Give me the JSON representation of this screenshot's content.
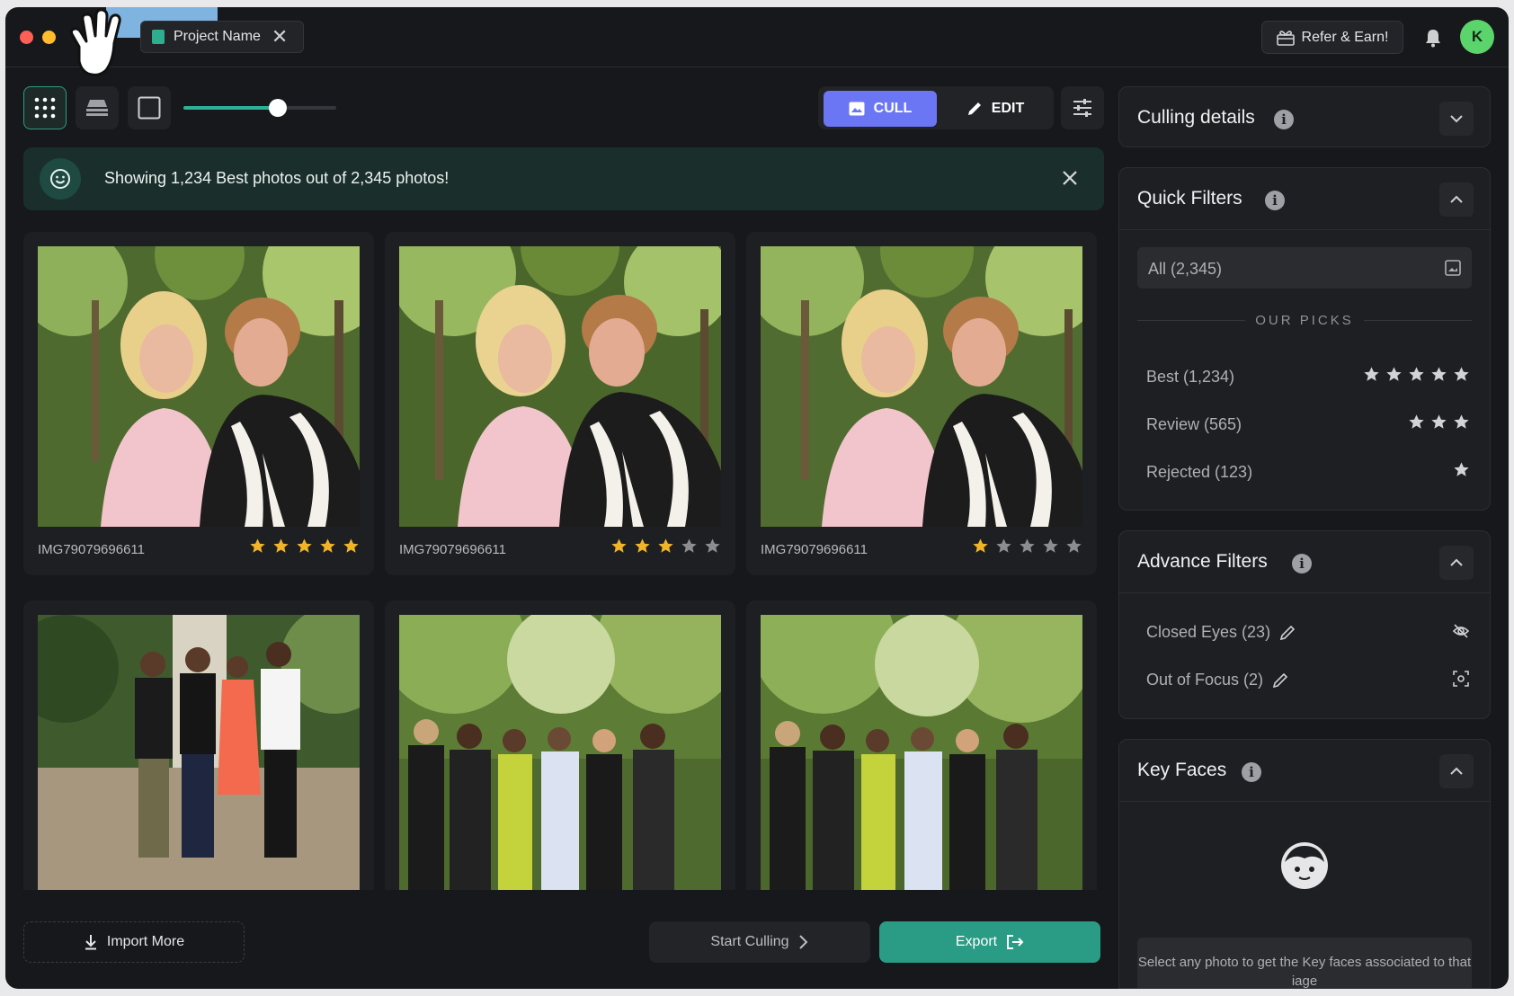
{
  "titlebar": {
    "project_tab": "Project Name",
    "refer_label": "Refer & Earn!",
    "avatar_initial": "K"
  },
  "toolbar": {
    "zoom_level": 0.62,
    "cull_label": "CULL",
    "edit_label": "EDIT"
  },
  "banner": {
    "message": "Showing 1,234 Best photos out of 2,345 photos!"
  },
  "photos": [
    {
      "filename": "IMG79079696611",
      "rating": 5,
      "scene": "duo",
      "variant": "a"
    },
    {
      "filename": "IMG79079696611",
      "rating": 3,
      "scene": "duo",
      "variant": "b"
    },
    {
      "filename": "IMG79079696611",
      "rating": 1,
      "scene": "duo",
      "variant": "c"
    },
    {
      "filename": "",
      "rating": 0,
      "scene": "four-people"
    },
    {
      "filename": "",
      "rating": 0,
      "scene": "group-women"
    },
    {
      "filename": "",
      "rating": 0,
      "scene": "group-women"
    }
  ],
  "actions": {
    "import_label": "Import More",
    "start_label": "Start Culling",
    "export_label": "Export"
  },
  "sidebar": {
    "culling_details": {
      "title": "Culling details"
    },
    "quick_filters": {
      "title": "Quick Filters",
      "all_label": "All (2,345)",
      "picks_heading": "OUR PICKS",
      "items": [
        {
          "label": "Best (1,234)",
          "stars": 5
        },
        {
          "label": "Review (565)",
          "stars": 3
        },
        {
          "label": "Rejected (123)",
          "stars": 1
        }
      ]
    },
    "advance_filters": {
      "title": "Advance Filters",
      "items": [
        {
          "label": "Closed Eyes (23)",
          "icon": "eye-off-icon"
        },
        {
          "label": "Out of Focus (2)",
          "icon": "focus-icon"
        }
      ]
    },
    "key_faces": {
      "title": "Key Faces",
      "message": "Select any photo to get the Key faces associated to that iage"
    }
  },
  "colors": {
    "accent_teal": "#2a9c85",
    "cull_purple": "#6b76f4",
    "star_gold": "#f0b429",
    "star_off": "#8c8d91"
  }
}
